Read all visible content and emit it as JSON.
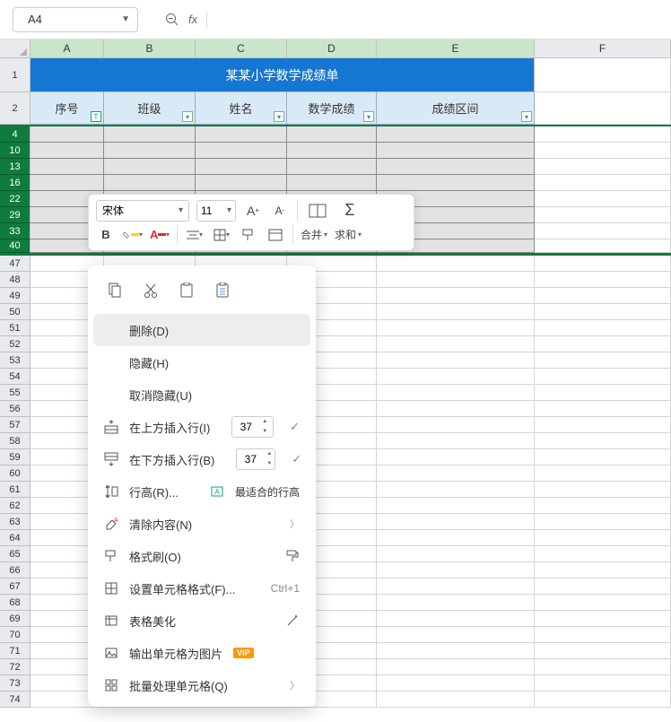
{
  "name_box": "A4",
  "fx_label": "fx",
  "columns": [
    "A",
    "B",
    "C",
    "D",
    "E",
    "F"
  ],
  "title_merged": "某某小学数学成绩单",
  "headers": {
    "a": "序号",
    "b": "班级",
    "c": "姓名",
    "d": "数学成绩",
    "e": "成绩区间"
  },
  "visible_row_nums_selected": [
    "4",
    "10",
    "13",
    "16",
    "22",
    "29",
    "33",
    "40"
  ],
  "visible_row_nums_normal": [
    "47",
    "48",
    "49",
    "50",
    "51",
    "52",
    "53",
    "54",
    "55",
    "56",
    "57",
    "58",
    "59",
    "60",
    "61",
    "62",
    "63",
    "64",
    "65",
    "66",
    "67",
    "68",
    "69",
    "70",
    "71",
    "72",
    "73",
    "74"
  ],
  "mini_toolbar": {
    "font_name": "宋体",
    "font_size": "11",
    "increase": "A",
    "decrease": "A",
    "bold": "B",
    "merge": "合并",
    "sum": "求和"
  },
  "ctx": {
    "delete": "删除(D)",
    "hide": "隐藏(H)",
    "unhide": "取消隐藏(U)",
    "insert_above": "在上方插入行(I)",
    "insert_below": "在下方插入行(B)",
    "insert_count_above": "37",
    "insert_count_below": "37",
    "row_height": "行高(R)...",
    "best_fit": "最适合的行高",
    "clear_content": "清除内容(N)",
    "format_painter": "格式刷(O)",
    "cell_format": "设置单元格格式(F)...",
    "cell_format_shortcut": "Ctrl+1",
    "beautify": "表格美化",
    "export_img": "输出单元格为图片",
    "vip": "VIP",
    "batch": "批量处理单元格(Q)"
  }
}
